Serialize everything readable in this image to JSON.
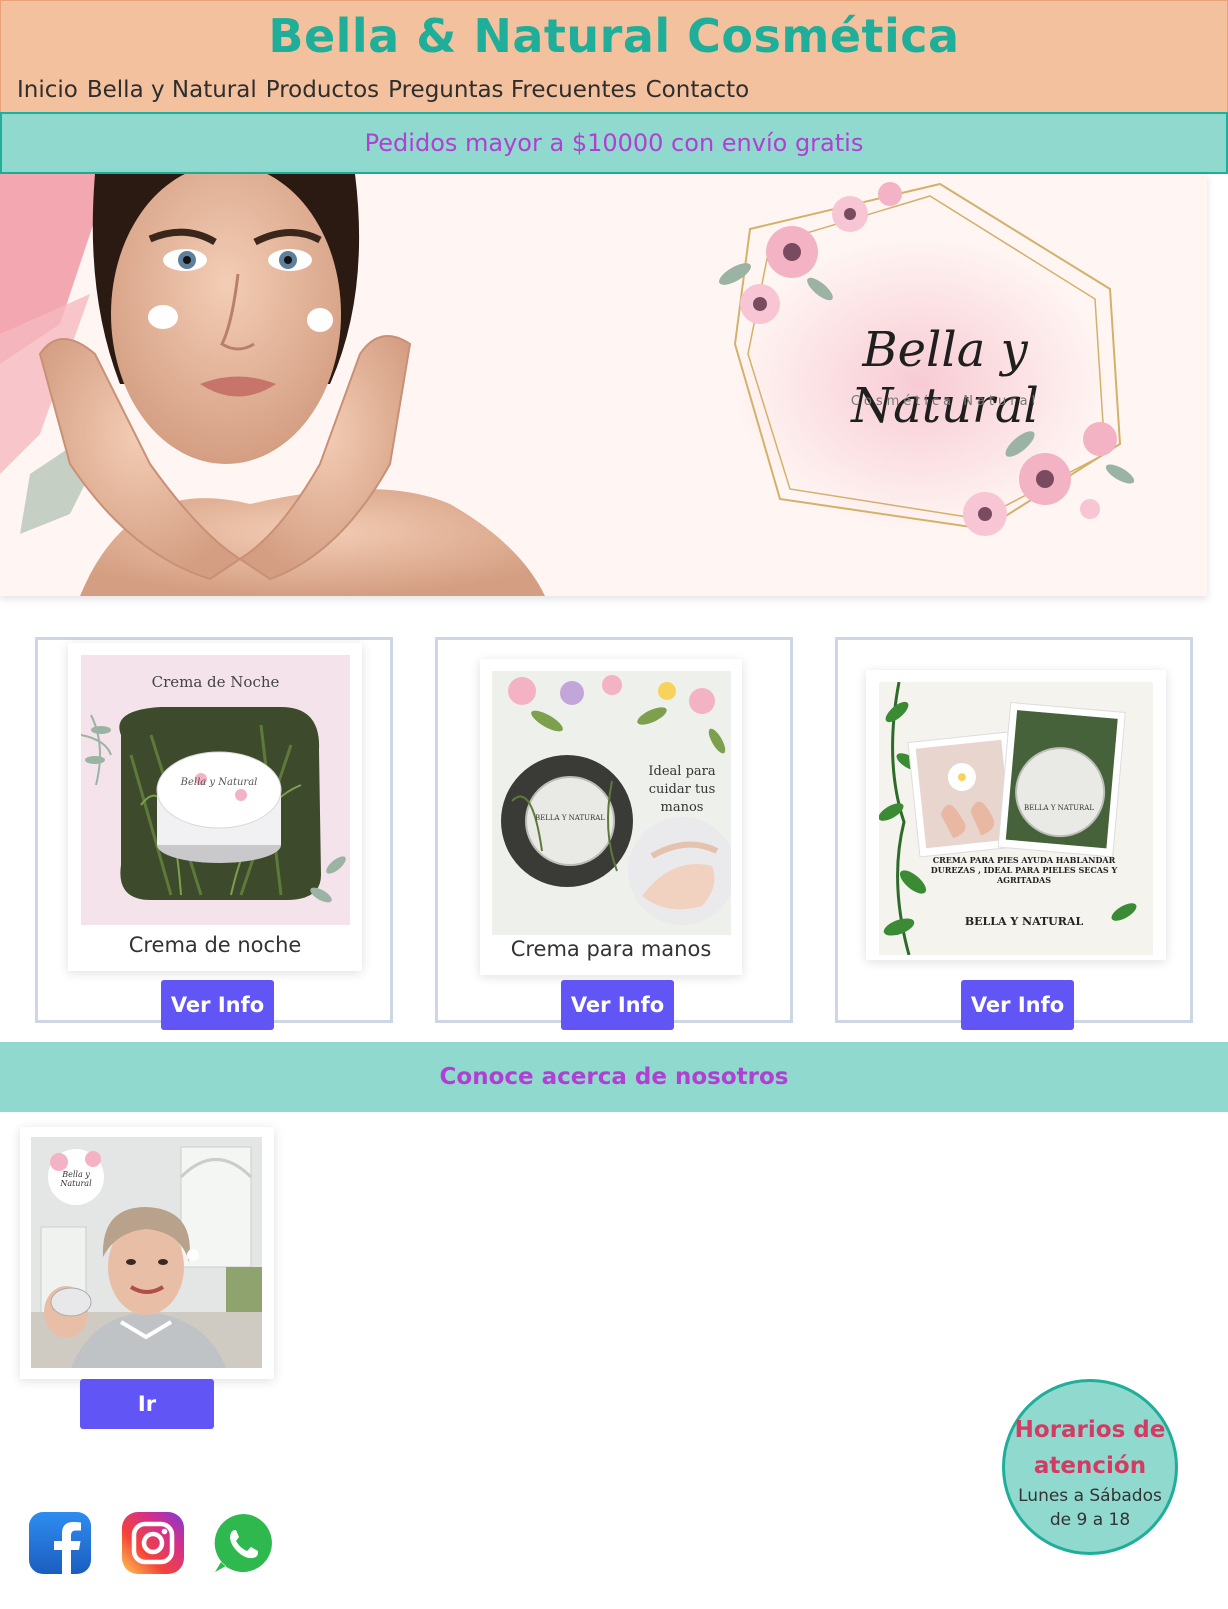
{
  "header": {
    "brand": "Bella & Natural Cosmética",
    "nav": [
      "Inicio",
      "Bella y Natural",
      "Productos",
      "Preguntas Frecuentes",
      "Contacto"
    ]
  },
  "promo": "Pedidos mayor a $10000 con envío gratis",
  "hero": {
    "logo_script": "Bella y Natural",
    "logo_sub": "Cosmética Natural"
  },
  "products": [
    {
      "title": "Crema de noche",
      "image_caption": "Crema de Noche",
      "jar_label": "Bella y Natural",
      "button": "Ver Info"
    },
    {
      "title": "Crema para manos",
      "image_caption": "Ideal para cuidar tus manos",
      "jar_label": "BELLA Y NATURAL",
      "button": "Ver Info"
    },
    {
      "title": "",
      "image_caption": "CREMA PARA PIES AYUDA HABLANDAR DUREZAS , IDEAL PARA PIELES SECAS Y AGRITADAS",
      "image_brand": "BELLA Y NATURAL",
      "jar_label": "BELLA Y NATURAL",
      "button": "Ver Info"
    }
  ],
  "about": {
    "bar": "Conoce acerca de nosotros",
    "photo_logo": "Bella y Natural",
    "button": "Ir"
  },
  "hours": {
    "title": "Horarios de atención",
    "text": "Lunes a Sábados de 9 a 18"
  },
  "social": [
    "facebook-icon",
    "instagram-icon",
    "whatsapp-icon"
  ],
  "colors": {
    "header_bg": "#f4c19e",
    "brand": "#1eae99",
    "promo_bg": "#8fd9ce",
    "promo_text": "#b23fd3",
    "button": "#6156f5",
    "hours_title": "#d33b62"
  }
}
